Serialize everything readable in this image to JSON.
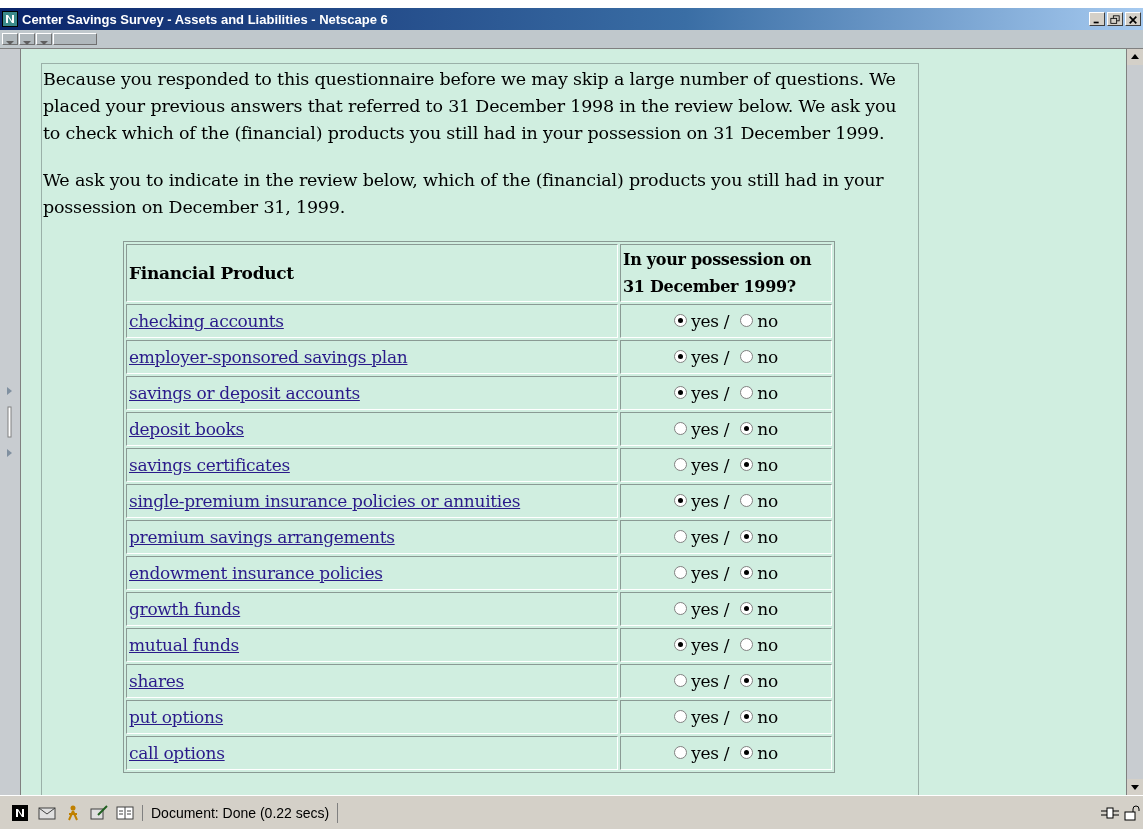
{
  "window": {
    "title": "Center Savings Survey - Assets and Liabilities - Netscape 6"
  },
  "intro": [
    "Because you responded to this questionnaire before we may skip a large number of questions. We placed your previous answers that referred to 31 December 1998 in the review below. We ask you to check which of the (financial) products you still had in your possession on 31 December 1999.",
    "We ask you to indicate in the review below, which of the (financial) products you still had in your possession on December 31, 1999."
  ],
  "table": {
    "columns": [
      "Financial Product",
      "In your possession on 31 December 1999?"
    ],
    "rows": [
      {
        "product": "checking accounts",
        "yes": true,
        "yes_label": "yes /",
        "no_label": "no"
      },
      {
        "product": "employer-sponsored savings plan",
        "yes": true,
        "yes_label": "yes /",
        "no_label": "no"
      },
      {
        "product": "savings or deposit accounts",
        "yes": true,
        "yes_label": "yes /",
        "no_label": "no"
      },
      {
        "product": "deposit books",
        "yes": false,
        "yes_label": "yes /",
        "no_label": "no"
      },
      {
        "product": "savings certificates",
        "yes": false,
        "yes_label": "yes /",
        "no_label": "no"
      },
      {
        "product": "single-premium insurance policies or annuities",
        "yes": true,
        "yes_label": "yes /",
        "no_label": "no"
      },
      {
        "product": "premium savings arrangements",
        "yes": false,
        "yes_label": "yes /",
        "no_label": "no"
      },
      {
        "product": "endowment insurance policies",
        "yes": false,
        "yes_label": "yes /",
        "no_label": "no"
      },
      {
        "product": "growth funds",
        "yes": false,
        "yes_label": "yes /",
        "no_label": "no"
      },
      {
        "product": "mutual funds",
        "yes": true,
        "yes_label": "yes /",
        "no_label": "no"
      },
      {
        "product": "shares",
        "yes": false,
        "yes_label": "yes /",
        "no_label": "no"
      },
      {
        "product": "put options",
        "yes": false,
        "yes_label": "yes /",
        "no_label": "no"
      },
      {
        "product": "call options",
        "yes": false,
        "yes_label": "yes /",
        "no_label": "no"
      }
    ]
  },
  "status_bar": {
    "text": "Document: Done (0.22 secs)"
  }
}
